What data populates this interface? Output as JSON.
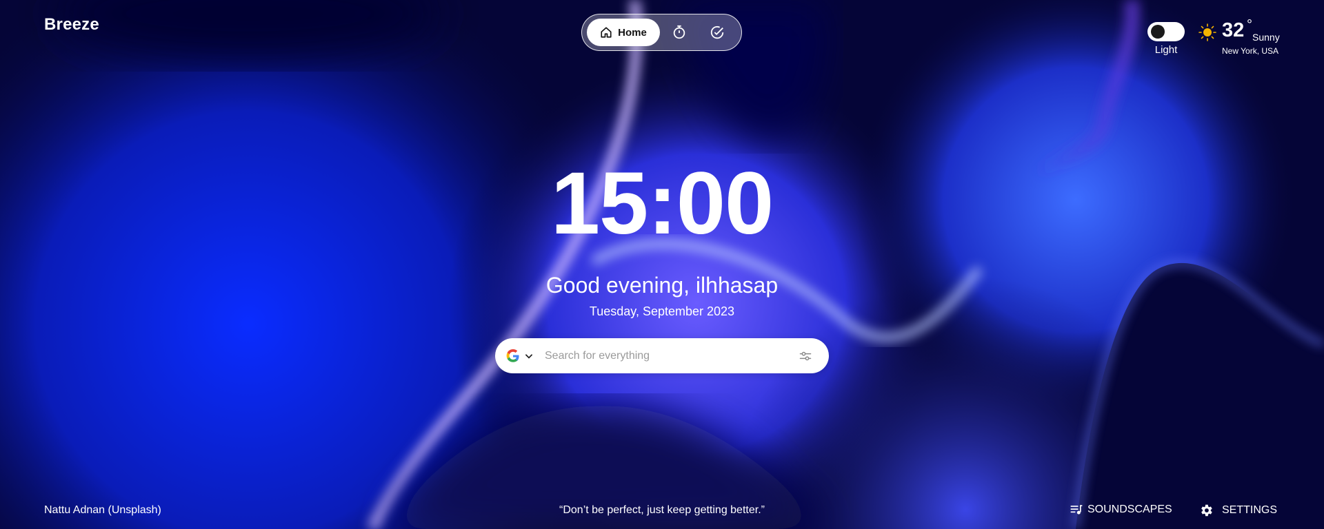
{
  "brand": "Breeze",
  "nav": {
    "home_label": "Home",
    "items": [
      {
        "name": "home",
        "icon": "home-icon"
      },
      {
        "name": "timer",
        "icon": "timer-icon"
      },
      {
        "name": "tasks",
        "icon": "check-circle-icon"
      }
    ]
  },
  "theme": {
    "label": "Light",
    "state": "dark-knob"
  },
  "weather": {
    "temperature": "32",
    "degree_symbol": "°",
    "condition": "Sunny",
    "location": "New York, USA",
    "icon": "sun-icon"
  },
  "clock": {
    "time": "15:00"
  },
  "greeting": "Good evening, ilhhasap",
  "date": "Tuesday, September 2023",
  "search": {
    "placeholder": "Search for everything",
    "engine_icon": "google-icon",
    "filter_icon": "sliders-icon"
  },
  "footer": {
    "photo_credit": "Nattu Adnan (Unsplash)",
    "quote": "“Don’t be perfect, just keep getting better.”",
    "soundscapes_label": "SOUNDSCAPES",
    "settings_label": "SETTINGS"
  },
  "colors": {
    "background_deep": "#050537",
    "background_blue": "#1434e6",
    "accent_violet": "#7a4ae8",
    "text": "#ffffff"
  }
}
